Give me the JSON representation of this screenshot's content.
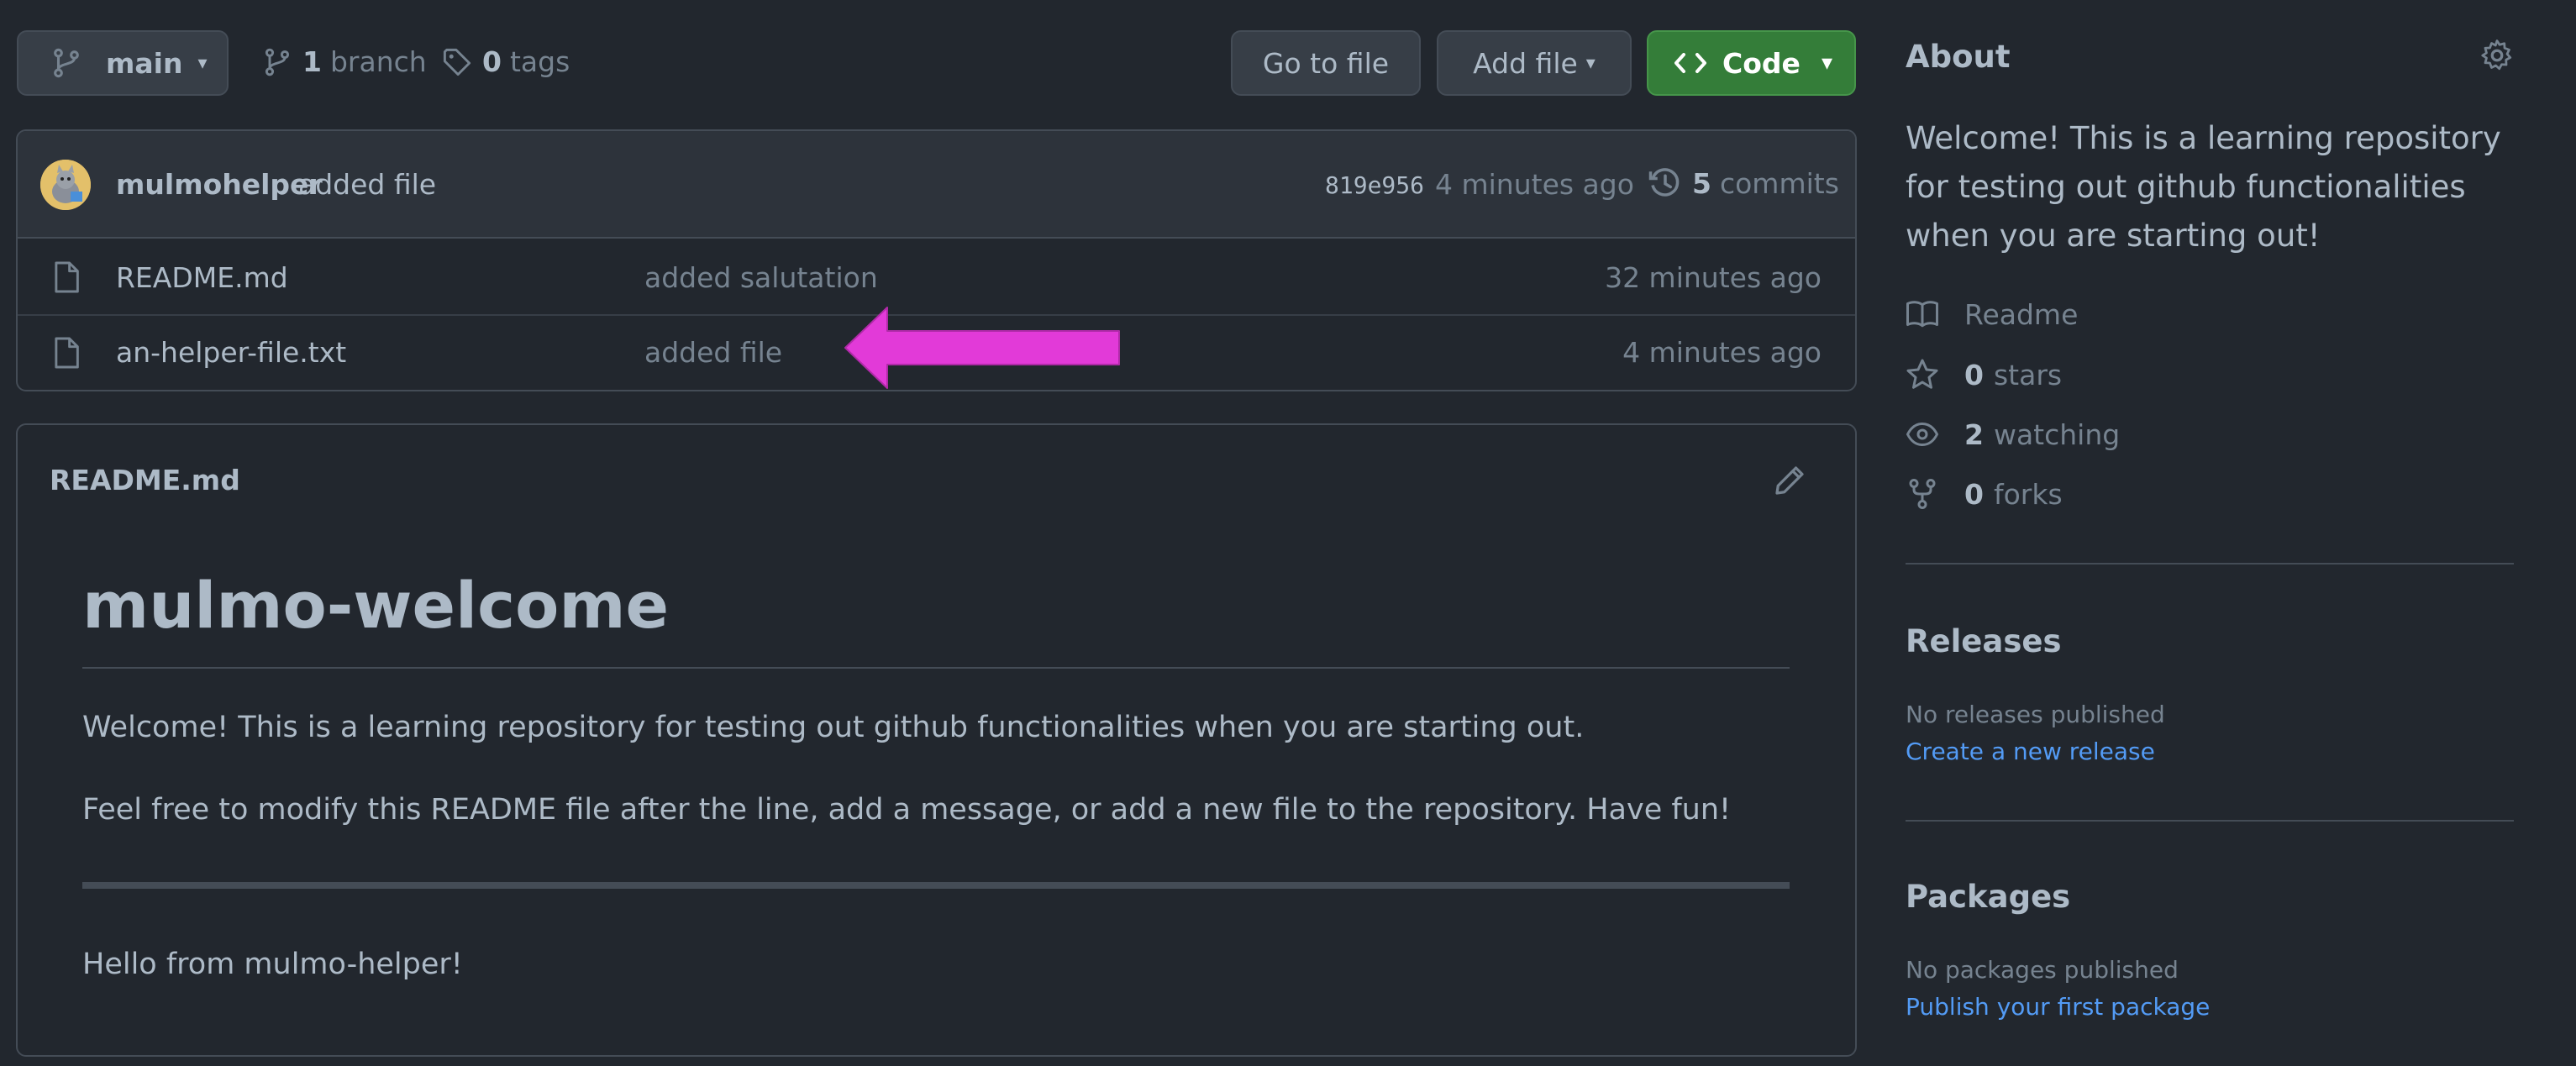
{
  "toolbar": {
    "branch_name": "main",
    "branch_count": "1",
    "branch_label": "branch",
    "tag_count": "0",
    "tag_label": "tags",
    "go_to_file": "Go to file",
    "add_file": "Add file",
    "code": "Code"
  },
  "commit": {
    "author": "mulmohelper",
    "message": "added file",
    "hash": "819e956",
    "time": "4 minutes ago",
    "commit_count": "5",
    "commit_label": "commits"
  },
  "files": [
    {
      "name": "README.md",
      "message": "added salutation",
      "time": "32 minutes ago"
    },
    {
      "name": "an-helper-file.txt",
      "message": "added file",
      "time": "4 minutes ago"
    }
  ],
  "readme": {
    "file_label": "README.md",
    "heading": "mulmo-welcome",
    "para1": "Welcome! This is a learning repository for testing out github functionalities when you are starting out.",
    "para2": "Feel free to modify this README file after the line, add a message, or add a new file to the repository. Have fun!",
    "para3": "Hello from mulmo-helper!"
  },
  "sidebar": {
    "about_title": "About",
    "description": "Welcome! This is a learning repository for testing out github functionalities when you are starting out!",
    "readme": "Readme",
    "stars_count": "0",
    "stars_label": "stars",
    "watching_count": "2",
    "watching_label": "watching",
    "forks_count": "0",
    "forks_label": "forks",
    "releases_title": "Releases",
    "no_releases": "No releases published",
    "create_release": "Create a new release",
    "packages_title": "Packages",
    "no_packages": "No packages published",
    "publish_package": "Publish your first package"
  },
  "colors": {
    "background": "#22272e",
    "code_button": "#347d39",
    "link": "#539bf5",
    "annotation_arrow": "#e23ad8"
  }
}
